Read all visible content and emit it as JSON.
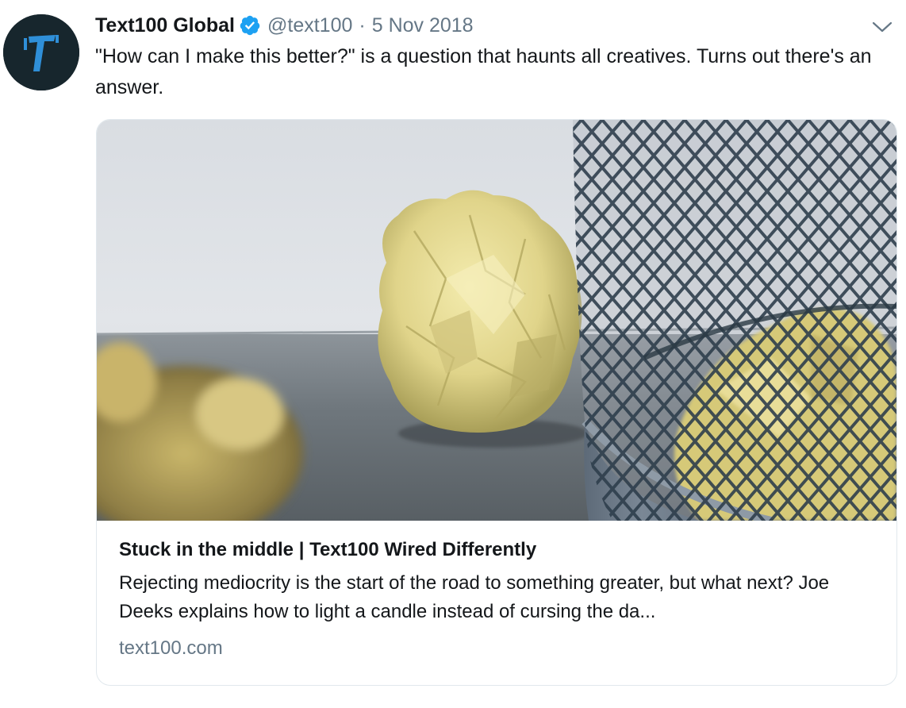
{
  "tweet": {
    "author": {
      "display_name": "Text100 Global",
      "handle": "@text100",
      "verified": true,
      "avatar_icon": "text100-logo-icon"
    },
    "separator": "·",
    "timestamp": "5 Nov 2018",
    "text": "\"How can I make this better?\" is a question that haunts all creatives. Turns out there's an answer.",
    "menu_icon": "chevron-down-icon"
  },
  "card": {
    "image_description": "crumpled-yellow-paper-wastebasket-photo",
    "title": "Stuck in the middle | Text100 Wired Differently",
    "description": "Rejecting mediocrity is the start of the road to something greater, but what next? Joe Deeks explains how to light a candle instead of cursing the da...",
    "domain": "text100.com"
  },
  "colors": {
    "text_primary": "#14171a",
    "text_secondary": "#657786",
    "verified_blue": "#1da1f2",
    "card_border": "#e1e8ed",
    "avatar_bg": "#17262d",
    "logo_accent": "#2f8fd8"
  }
}
